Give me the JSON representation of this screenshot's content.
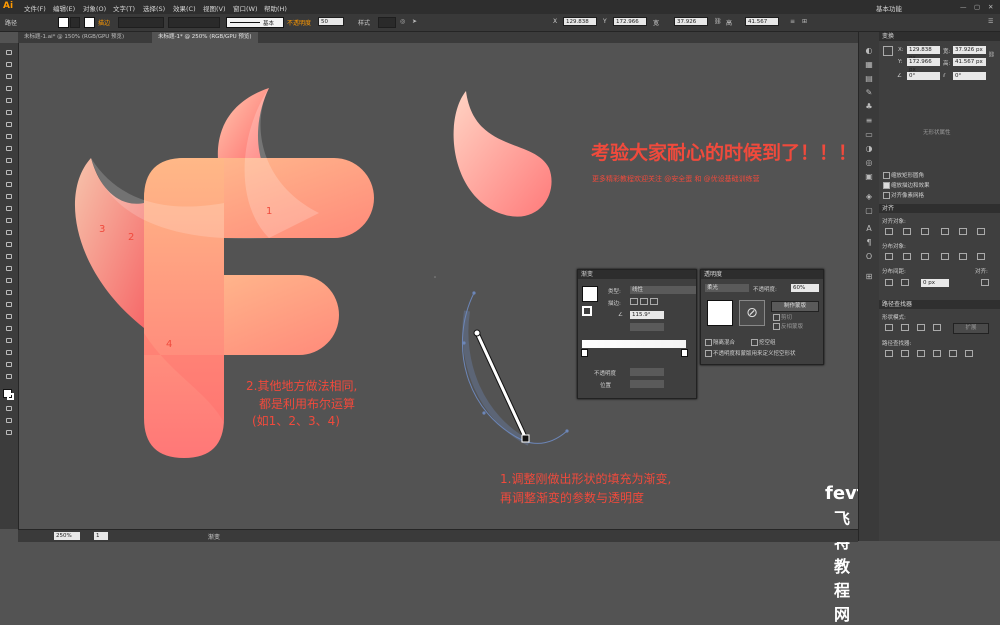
{
  "app": {
    "logo": "Ai"
  },
  "menu": [
    "文件(F)",
    "编辑(E)",
    "对象(O)",
    "文字(T)",
    "选择(S)",
    "效果(C)",
    "视图(V)",
    "窗口(W)",
    "帮助(H)"
  ],
  "menu_right": {
    "workspace": "基本功能"
  },
  "control_bar": {
    "path_label": "路径",
    "stroke_label": "描边",
    "stroke_style": "基本",
    "opacity_label": "不透明度",
    "opacity_value": "50",
    "style_label": "样式",
    "x_label": "X",
    "x_value": "129.838",
    "y_label": "Y",
    "y_value": "172.966",
    "w_label": "宽",
    "w_value": "37.926",
    "h_label": "高",
    "h_value": "41.567"
  },
  "tabs": [
    {
      "label": "未标题-1.ai* @ 150% (RGB/GPU 预览)"
    },
    {
      "label": "未标题-1* @ 250% (RGB/GPU 预览)"
    }
  ],
  "status": {
    "zoom": "250%",
    "page": "1",
    "mode": "渐变"
  },
  "transform_panel": {
    "title": "变换",
    "x_label": "X:",
    "x_value": "129.838 px",
    "y_label": "Y:",
    "y_value": "172.966 px",
    "w_label": "宽:",
    "w_value": "37.926 px",
    "h_label": "高:",
    "h_value": "41.567 px",
    "angle_value": "0°",
    "shear_value": "0°",
    "shape_props": "无形状属性",
    "checkboxes": [
      "缩放矩形圆角",
      "缩放描边和效果",
      "对齐像素网格"
    ]
  },
  "align_panel": {
    "title": "对齐",
    "align_objects": "对齐对象:",
    "distribute_objects": "分布对象:",
    "distribute_spacing": "分布间距:",
    "align_to": "对齐:",
    "spacing_value": "0 px"
  },
  "pathfinder_panel": {
    "title": "路径查找器",
    "shape_modes": "形状模式:",
    "expand": "扩展",
    "pathfinders": "路径查找器:"
  },
  "gradient_panel": {
    "title": "渐变",
    "type_label": "类型:",
    "type_value": "线性",
    "stroke_label": "描边:",
    "angle_value": "115.9°",
    "opacity_label": "不透明度",
    "location_label": "位置"
  },
  "transparency_panel": {
    "title": "透明度",
    "blend_value": "柔光",
    "opacity_label": "不透明度:",
    "opacity_value": "60%",
    "make_mask": "制作蒙版",
    "clip": "剪切",
    "invert_mask": "反相蒙版",
    "isolate_blending": "隔离混合",
    "knockout_group": "挖空组",
    "opacity_mask_define": "不透明度和蒙版用来定义挖空形状"
  },
  "annotations": {
    "headline": "考验大家耐心的时候到了！！！",
    "subline": "更多精彩教程欢迎关注 @安全蛋 和 @优设基础训练营",
    "note2_line1": "2.其他地方做法相同,",
    "note2_line2": "都是利用布尔运算",
    "note2_line3": "(如1、2、3、4)",
    "note1_line1": "1.调整刚做出形状的填充为渐变,",
    "note1_line2": "再调整渐变的参数与透明度",
    "num1": "1",
    "num2": "2",
    "num3": "3",
    "num4": "4"
  },
  "watermark": {
    "line1": "fevte.com",
    "line2": "飞特教程网"
  },
  "colors": {
    "accent": "#f04a3c",
    "gradient_start": "#ffb58a",
    "gradient_end": "#ff6f6f"
  }
}
